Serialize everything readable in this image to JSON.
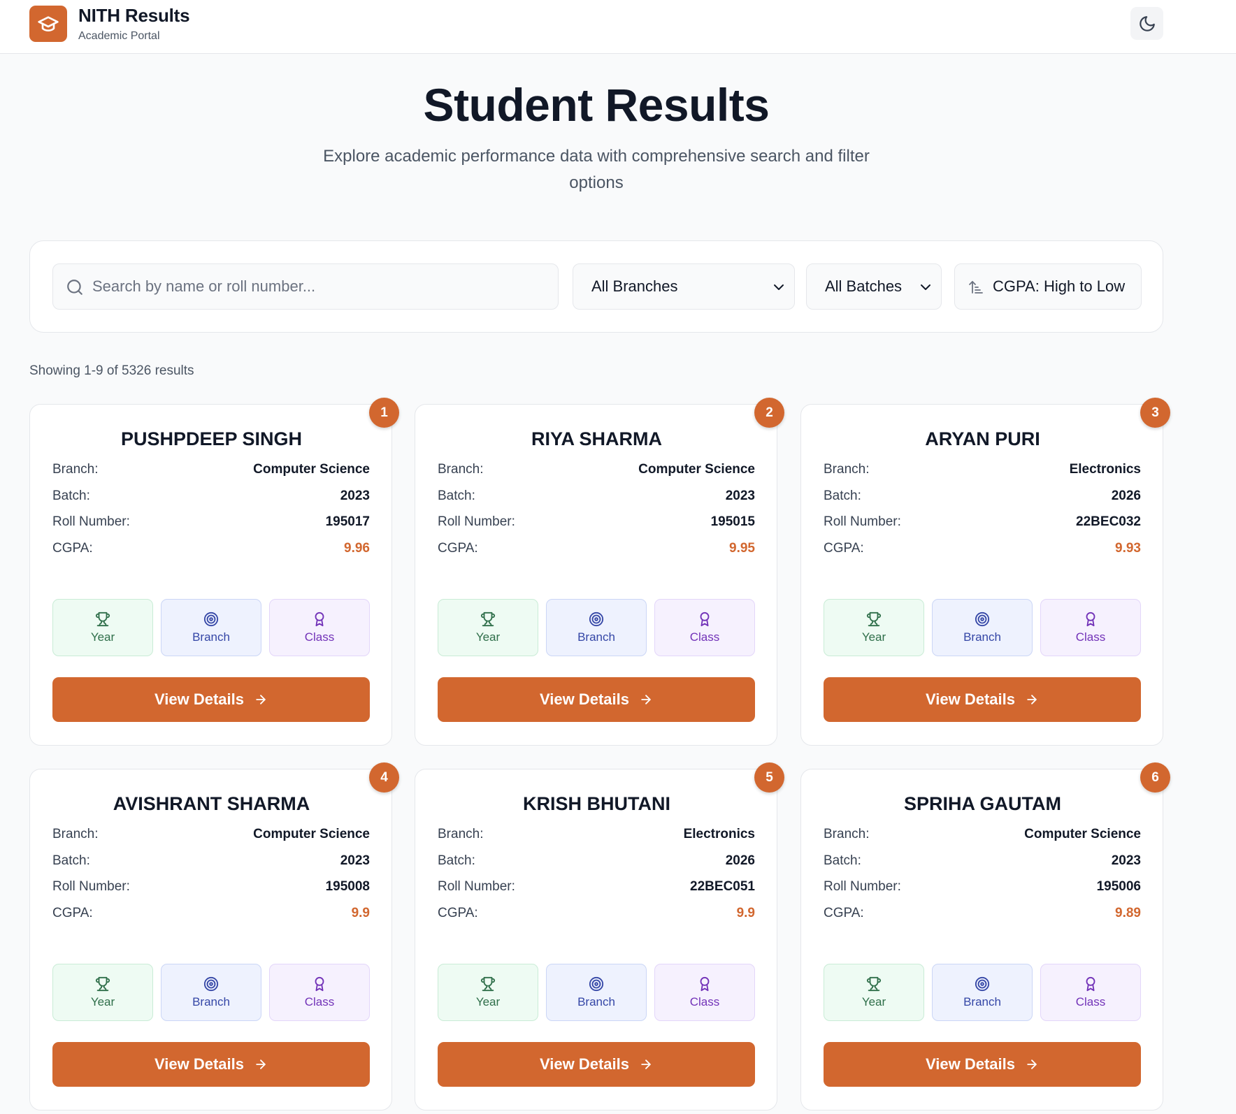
{
  "header": {
    "brand_name": "NITH Results",
    "brand_sub": "Academic Portal",
    "logo_icon": "graduation-cap-icon",
    "theme_toggle_icon": "moon-icon"
  },
  "hero": {
    "title": "Student Results",
    "subtitle": "Explore academic performance data with comprehensive search and filter options"
  },
  "filters": {
    "search_placeholder": "Search by name or roll number...",
    "search_value": "",
    "branch_select": "All Branches",
    "batch_select": "All Batches",
    "sort_label": "CGPA: High to Low"
  },
  "results_count": "Showing 1-9 of 5326 results",
  "labels": {
    "branch": "Branch:",
    "batch": "Batch:",
    "roll": "Roll Number:",
    "cgpa": "CGPA:",
    "tile_year": "Year",
    "tile_branch": "Branch",
    "tile_class": "Class",
    "view_details": "View Details"
  },
  "students": [
    {
      "rank": "1",
      "name": "PUSHPDEEP SINGH",
      "branch": "Computer Science",
      "batch": "2023",
      "roll": "195017",
      "cgpa": "9.96"
    },
    {
      "rank": "2",
      "name": "RIYA SHARMA",
      "branch": "Computer Science",
      "batch": "2023",
      "roll": "195015",
      "cgpa": "9.95"
    },
    {
      "rank": "3",
      "name": "ARYAN PURI",
      "branch": "Electronics",
      "batch": "2026",
      "roll": "22BEC032",
      "cgpa": "9.93"
    },
    {
      "rank": "4",
      "name": "AVISHRANT SHARMA",
      "branch": "Computer Science",
      "batch": "2023",
      "roll": "195008",
      "cgpa": "9.9"
    },
    {
      "rank": "5",
      "name": "KRISH BHUTANI",
      "branch": "Electronics",
      "batch": "2026",
      "roll": "22BEC051",
      "cgpa": "9.9"
    },
    {
      "rank": "6",
      "name": "SPRIHA GAUTAM",
      "branch": "Computer Science",
      "batch": "2023",
      "roll": "195006",
      "cgpa": "9.89"
    }
  ],
  "colors": {
    "accent": "#d2672f",
    "year_tile": "#eefbf3",
    "branch_tile": "#eef2fe",
    "class_tile": "#f6f1fe"
  }
}
